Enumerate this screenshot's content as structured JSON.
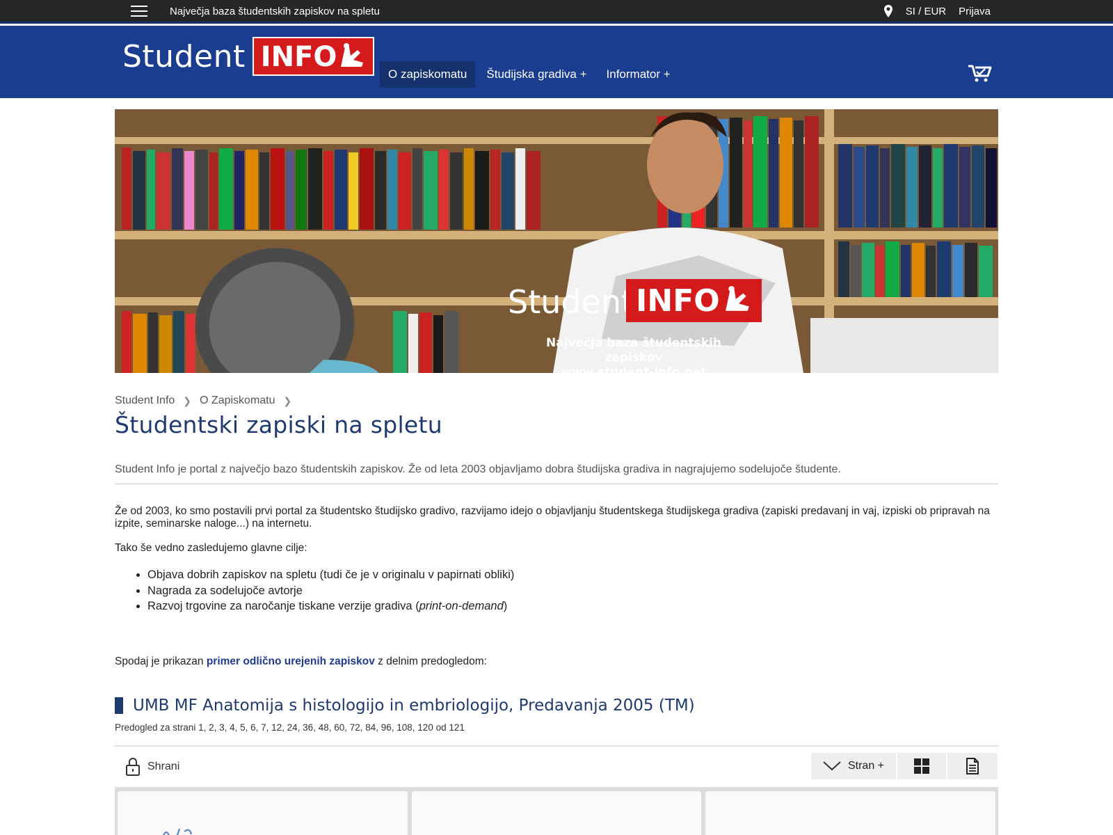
{
  "topbar": {
    "tagline": "Največja baza študentskih zapiskov na spletu",
    "locale": "SI / EUR",
    "login": "Prijava"
  },
  "header": {
    "logo_student": "Student",
    "logo_info": "INFO",
    "nav": [
      {
        "label": "O zapiskomatu",
        "active": true
      },
      {
        "label": "Študijska gradiva +",
        "active": false
      },
      {
        "label": "Informator +",
        "active": false
      }
    ]
  },
  "hero": {
    "brand_student": "Student",
    "brand_info": "INFO",
    "tagline_line1": "Največja baza študentskih zapiskov",
    "tagline_line2": "www.student-info.net"
  },
  "breadcrumb": [
    "Student Info",
    "O Zapiskomatu"
  ],
  "page": {
    "title": "Študentski zapiski na spletu",
    "lead": "Student Info je portal z največjo bazo študentskih zapiskov. Že od leta 2003 objavljamo dobra študijska gradiva in nagrajujemo sodelujoče študente.",
    "para1": "Že od 2003, ko smo postavili prvi portal za študentsko študijsko gradivo, razvijamo idejo o objavljanju študentskega študijskega gradiva (zapiski predavanj in vaj, izpiski ob pripravah na izpite, seminarske naloge...) na internetu.",
    "para2": "Tako še vedno zasledujemo glavne cilje:",
    "goals": [
      "Objava dobrih zapiskov na spletu (tudi če je v originalu v papirnati obliki)",
      "Nagrada za sodelujoče avtorje",
      "Razvoj trgovine za naročanje tiskane verzije gradiva ("
    ],
    "goal3_italic": "print-on-demand",
    "goal3_end": ")",
    "para3_before": "Spodaj je prikazan ",
    "para3_link": "primer odlično urejenih zapiskov",
    "para3_after": " z delnim predogledom:"
  },
  "document": {
    "title": "UMB MF Anatomija s histologijo in embriologijo, Predavanja 2005 (TM)",
    "preview": "Predogled za strani 1, 2, 3, 4, 5, 6, 7, 12, 24, 36, 48, 60, 72, 84, 96, 108, 120 od 121"
  },
  "toolbar": {
    "save": "Shrani",
    "page": "Stran +"
  },
  "colors": {
    "header_blue": "#1a3d8f",
    "topbar_dark": "#262626",
    "brand_red": "#d41a1a",
    "title_blue": "#1f3a6e"
  }
}
